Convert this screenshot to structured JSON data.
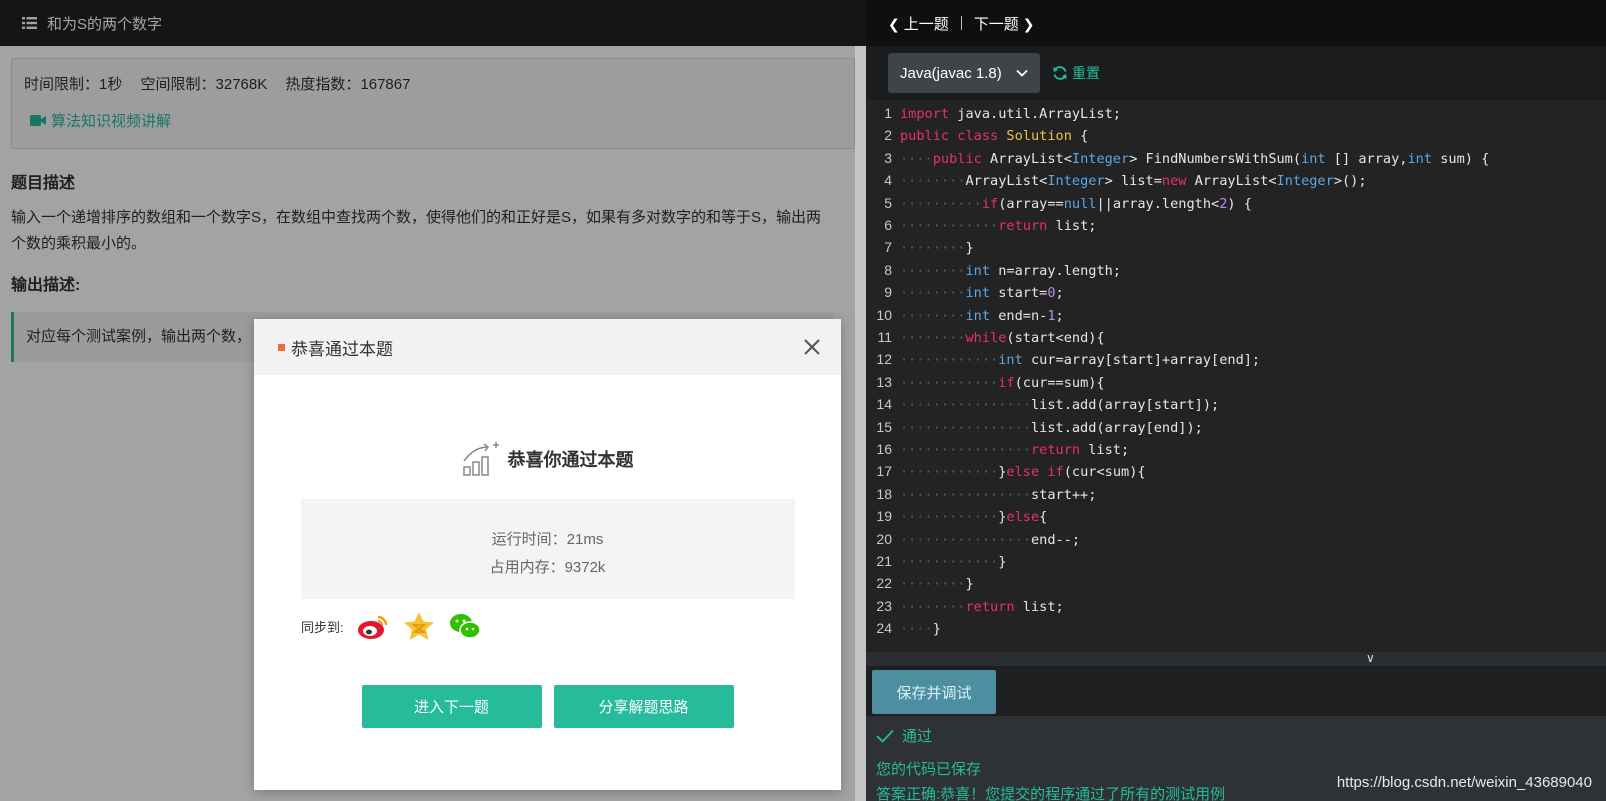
{
  "problem": {
    "title": "和为S的两个数字",
    "time_limit": "时间限制：1秒",
    "space_limit": "空间限制：32768K",
    "hot_index": "热度指数：167867",
    "video_link": "算法知识视频讲解",
    "desc_title": "题目描述",
    "description": "输入一个递增排序的数组和一个数字S，在数组中查找两个数，使得他们的和正好是S，如果有多对数字的和等于S，输出两个数的乘积最小的。",
    "output_title": "输出描述:",
    "output_text": "对应每个测试案例，输出两个数，"
  },
  "nav": {
    "prev": "上一题",
    "next": "下一题"
  },
  "toolbar": {
    "language": "Java(javac 1.8)",
    "reset": "重置"
  },
  "code_lines": [
    "import java.util.ArrayList;",
    "public class Solution {",
    "    public ArrayList<Integer> FindNumbersWithSum(int [] array,int sum) {",
    "        ArrayList<Integer> list=new ArrayList<Integer>();",
    "          if(array==null||array.length<2) {",
    "            return list;",
    "        }",
    "        int n=array.length;",
    "        int start=0;",
    "        int end=n-1;",
    "        while(start<end){",
    "            int cur=array[start]+array[end];",
    "            if(cur==sum){",
    "                list.add(array[start]);",
    "                list.add(array[end]);",
    "                return list;",
    "            }else if(cur<sum){",
    "                start++;",
    "            }else{",
    "                end--;",
    "            }",
    "        }",
    "        return list;",
    "    }"
  ],
  "actions": {
    "save_debug": "保存并调试"
  },
  "result": {
    "pass": "通过",
    "saved": "您的代码已保存",
    "correct": "答案正确:恭喜！您提交的程序通过了所有的测试用例"
  },
  "watermark": "https://blog.csdn.net/weixin_43689040",
  "modal": {
    "title": "恭喜通过本题",
    "congrats": "恭喜你通过本题",
    "run_time": "运行时间：21ms",
    "memory": "占用内存：9372k",
    "share_label": "同步到:",
    "next_button": "进入下一题",
    "share_button": "分享解题思路"
  },
  "colors": {
    "accent": "#25bb9b",
    "keyword": "#e6306b",
    "type": "#5aa7e6",
    "class": "#f0c04a",
    "number": "#b98cf0"
  },
  "icons": [
    "list-icon",
    "video-camera-icon",
    "chevron-left-icon",
    "chevron-right-icon",
    "chevron-down-icon",
    "refresh-icon",
    "check-icon",
    "close-icon",
    "chart-growth-icon",
    "weibo-icon",
    "qzone-icon",
    "wechat-icon"
  ]
}
